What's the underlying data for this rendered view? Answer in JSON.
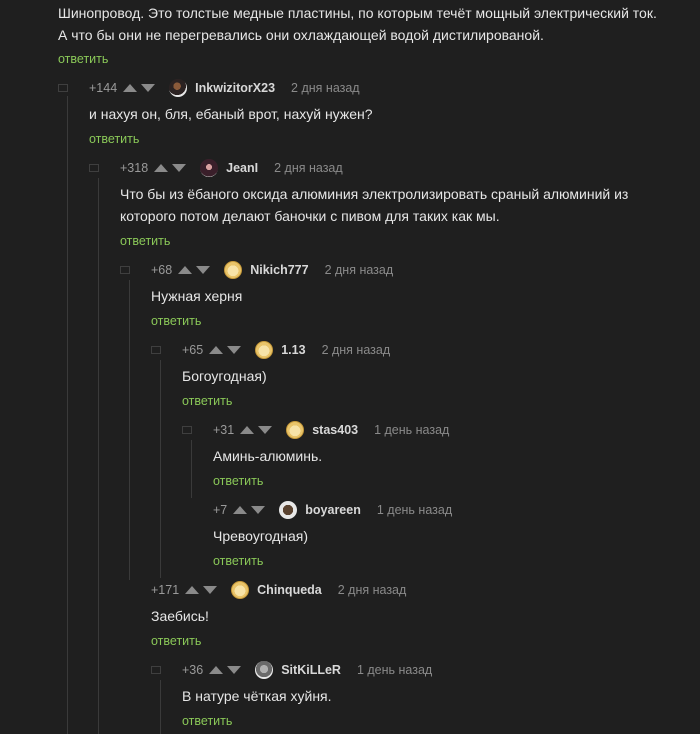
{
  "root": {
    "text_lines": [
      "Шинопровод. Это толстые медные пластины, по которым течёт мощный электрический ток.",
      "А что бы они не перегревались они охлаждающей водой дистилированой."
    ],
    "reply": "ответить"
  },
  "comments": [
    {
      "rating": "+144",
      "user": "InkwizitorX23",
      "time": "2 дня назад",
      "lines": [
        "и нахуя он, бля, ебаный врот, нахуй нужен?"
      ],
      "reply": "ответить"
    },
    {
      "rating": "+318",
      "user": "JeanI",
      "time": "2 дня назад",
      "lines": [
        "Что бы из ёбаного оксида алюминия электролизировать сраный алюминий из",
        "которого потом делают баночки с пивом для таких как мы."
      ],
      "reply": "ответить"
    },
    {
      "rating": "+68",
      "user": "Nikich777",
      "time": "2 дня назад",
      "lines": [
        "Нужная херня"
      ],
      "reply": "ответить"
    },
    {
      "rating": "+65",
      "user": "1.13",
      "time": "2 дня назад",
      "lines": [
        "Богоугодная)"
      ],
      "reply": "ответить"
    },
    {
      "rating": "+31",
      "user": "stas403",
      "time": "1 день назад",
      "lines": [
        "Аминь-алюминь."
      ],
      "reply": "ответить"
    },
    {
      "rating": "+7",
      "user": "boyareen",
      "time": "1 день назад",
      "lines": [
        "Чревоугодная)"
      ],
      "reply": "ответить"
    },
    {
      "rating": "+171",
      "user": "Chinqueda",
      "time": "2 дня назад",
      "lines": [
        "Заебись!"
      ],
      "reply": "ответить"
    },
    {
      "rating": "+36",
      "user": "SitKiLLeR",
      "time": "1 день назад",
      "lines": [
        "В натуре чёткая хуйня."
      ],
      "reply": "ответить"
    }
  ],
  "colors": {
    "background": "#1f1f1f",
    "reply_link": "#8ac858",
    "text": "#e6e6e6",
    "meta": "#8a8a8a"
  }
}
